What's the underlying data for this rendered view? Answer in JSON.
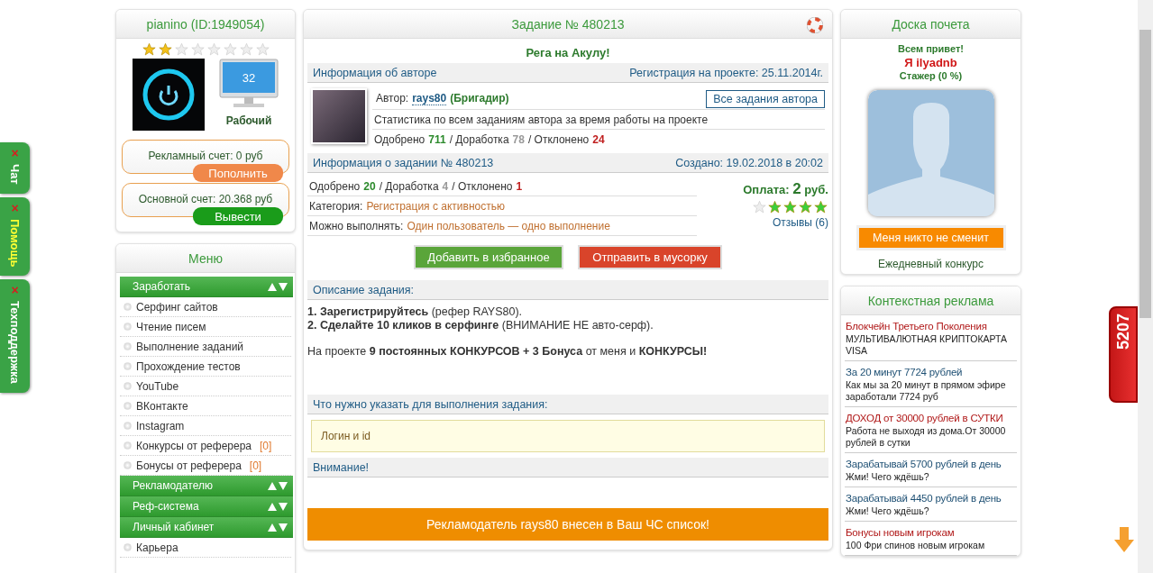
{
  "side_tabs": [
    {
      "label": "Чат",
      "color": "#ffffff",
      "close": "×"
    },
    {
      "label": "Помощь",
      "color": "#ffff33",
      "close": "×"
    },
    {
      "label": "Техподдержка",
      "color": "#ffffff",
      "close": "×"
    }
  ],
  "profile": {
    "title": "pianino (ID:1949054)",
    "stars": 2,
    "monitor_value": "32",
    "status": "Рабочий",
    "accounts": [
      {
        "label": "Рекламный счет: 0 руб",
        "action": "Пополнить",
        "kind": "topup"
      },
      {
        "label": "Основной счет: 20.368 руб",
        "action": "Вывести",
        "kind": "withdraw"
      }
    ]
  },
  "menu": {
    "title": "Меню",
    "sections": [
      {
        "label": "Заработать",
        "children": [
          {
            "label": "Серфинг сайтов"
          },
          {
            "label": "Чтение писем"
          },
          {
            "label": "Выполнение заданий"
          },
          {
            "label": "Прохождение тестов"
          },
          {
            "label": "YouTube"
          },
          {
            "label": "ВКонтакте"
          },
          {
            "label": "Instagram"
          },
          {
            "label": "Конкурсы от реферера",
            "count": "[0]"
          },
          {
            "label": "Бонусы от реферера",
            "count": "[0]"
          }
        ]
      },
      {
        "label": "Рекламодателю"
      },
      {
        "label": "Реф-система"
      },
      {
        "label": "Личный кабинет",
        "children": [
          {
            "label": "Карьера"
          }
        ]
      }
    ]
  },
  "task": {
    "title": "Задание № 480213",
    "headline": "Рега на Акулу!",
    "author_section": {
      "title": "Информация об авторе",
      "aside": "Регистрация на проекте: 25.11.2014г."
    },
    "author": {
      "label": "Автор:",
      "name": "rays80",
      "rank": "(Бригадир)",
      "all_tasks_button": "Все задания автора",
      "stats_caption": "Статистика по всем заданиям автора за время работы на проекте",
      "stats": [
        {
          "label": "Одобрено",
          "value": "711",
          "kind": "approved"
        },
        {
          "label": "/ Доработка",
          "value": "78",
          "kind": "rework"
        },
        {
          "label": "/ Отклонено",
          "value": "24",
          "kind": "rejected"
        }
      ]
    },
    "task_section": {
      "title": "Информация о задании № 480213",
      "aside": "Создано: 19.02.2018 в 20:02"
    },
    "task_stats": [
      {
        "label": "Одобрено",
        "value": "20",
        "kind": "approved"
      },
      {
        "label": "/ Доработка",
        "value": "4",
        "kind": "rework"
      },
      {
        "label": "/ Отклонено",
        "value": "1",
        "kind": "rejected"
      }
    ],
    "details": [
      {
        "label": "Категория:",
        "value": "Регистрация с активностью"
      },
      {
        "label": "Можно выполнять:",
        "value": "Один пользователь — одно выполнение"
      }
    ],
    "payment": {
      "label": "Оплата:",
      "amount": "2",
      "unit": "руб."
    },
    "rating": {
      "stars": 4
    },
    "reviews": "Отзывы (6)",
    "buttons": [
      {
        "label": "Добавить в избранное",
        "kind": "favorite"
      },
      {
        "label": "Отправить в мусорку",
        "kind": "trash"
      }
    ],
    "description": {
      "title": "Описание задания:",
      "paragraphs": [
        [
          "**1. Зарегистрируйтесь** (рефер RAYS80).",
          "**2. Сделайте 10 кликов в серфинге** (ВНИМАНИЕ НЕ авто-серф)."
        ],
        [
          "На проекте **9 постоянных КОНКУРСОВ + 3 Бонуса** от меня и **КОНКУРСЫ!**"
        ]
      ]
    },
    "requirement": {
      "title": "Что нужно указать для выполнения задания:",
      "value": "Логин и id"
    },
    "attention": {
      "title": "Внимание!"
    },
    "notice": "Рекламодатель rays80 внесен в Ваш ЧС список!"
  },
  "honor": {
    "title": "Доска почета",
    "greeting": "Всем привет!",
    "user": "Я ilyadnb",
    "rank": "Стажер (0 %)",
    "button": "Меня никто не сменит",
    "caption": "Ежедневный конкурс"
  },
  "ads": {
    "title": "Контекстная реклама",
    "items": [
      {
        "title": "Блокчейн Третьего Поколения",
        "color": "#b01818",
        "text": "МУЛЬТИВАЛЮТНАЯ КРИПТОКАРТА VISA"
      },
      {
        "title": "За 20 минут 7724 рублей",
        "color": "#1d4f73",
        "text": "Как мы за 20 минут в прямом эфире заработали 7724 руб"
      },
      {
        "title": "ДОХОД от 30000 рублей в СУТКИ",
        "color": "#b01818",
        "text": "Работа не выходя из дома.От 30000 рублей в сутки"
      },
      {
        "title": "Зарабатывай 5700 рублей в день",
        "color": "#1d4f73",
        "text": "Жми! Чего ждёшь?"
      },
      {
        "title": "Зарабатывай 4450 рублей в день",
        "color": "#1d4f73",
        "text": "Жми! Чего ждёшь?"
      },
      {
        "title": "Бонусы новым игрокам",
        "color": "#b01818",
        "text": "100 Фри спинов новым игрокам"
      }
    ]
  },
  "badge": "5207"
}
